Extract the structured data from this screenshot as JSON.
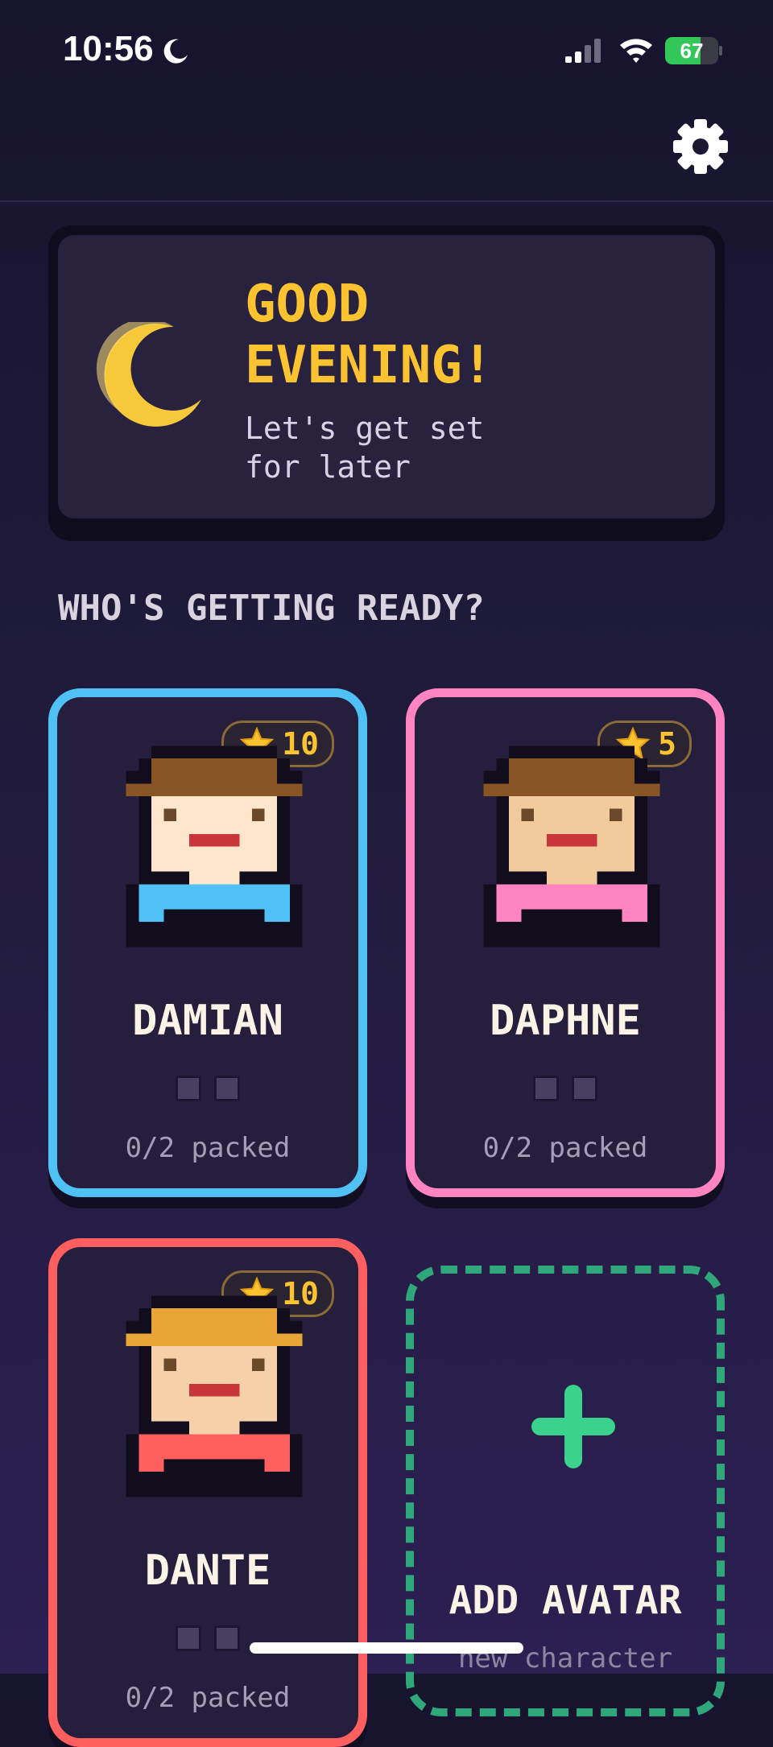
{
  "status_bar": {
    "time": "10:56",
    "battery": "67",
    "battery_level": 0.67
  },
  "greeting": {
    "title": "GOOD\nEVENING!",
    "subtitle": "Let's get set\nfor later"
  },
  "section_title": "WHO'S GETTING READY?",
  "characters": [
    {
      "name": "DAMIAN",
      "stars": "10",
      "progress": "0/2 packed",
      "border": "#4fc1f5",
      "hair": "#8a5524",
      "skin": "#fde6cc",
      "shirt": "#4fc1f5"
    },
    {
      "name": "DAPHNE",
      "stars": "5",
      "progress": "0/2 packed",
      "border": "#ff84c1",
      "hair": "#8a5524",
      "skin": "#f2cb9d",
      "shirt": "#ff84c1"
    },
    {
      "name": "DANTE",
      "stars": "10",
      "progress": "0/2 packed",
      "border": "#ff5f5f",
      "hair": "#e9a537",
      "skin": "#f5d0a9",
      "shirt": "#ff5f5f"
    }
  ],
  "add_avatar": {
    "label": "ADD AVATAR",
    "sublabel": "new character",
    "accent": "#3ad28c"
  },
  "icons": {
    "settings": "gear-icon",
    "star": "star-icon",
    "greeting": "crescent-moon-icon",
    "add": "plus-icon"
  }
}
